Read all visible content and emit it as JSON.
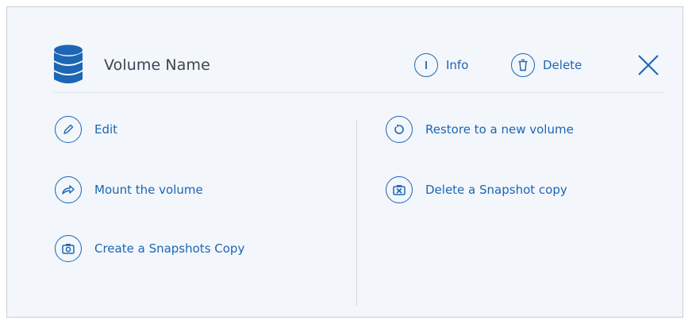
{
  "panel": {
    "title": "Volume Name",
    "header_actions": {
      "info_label": "Info",
      "delete_label": "Delete"
    }
  },
  "actions_left": [
    {
      "label": "Edit",
      "icon": "pencil-icon"
    },
    {
      "label": "Mount the volume",
      "icon": "share-arrow-icon"
    },
    {
      "label": "Create a Snapshots Copy",
      "icon": "camera-icon"
    }
  ],
  "actions_right": [
    {
      "label": "Restore to a new volume",
      "icon": "restore-icon"
    },
    {
      "label": "Delete a Snapshot copy",
      "icon": "delete-snapshot-icon"
    }
  ],
  "colors": {
    "accent": "#1c66b5",
    "title": "#3b4656",
    "background": "#f3f6fa",
    "border": "#c9ced6"
  }
}
